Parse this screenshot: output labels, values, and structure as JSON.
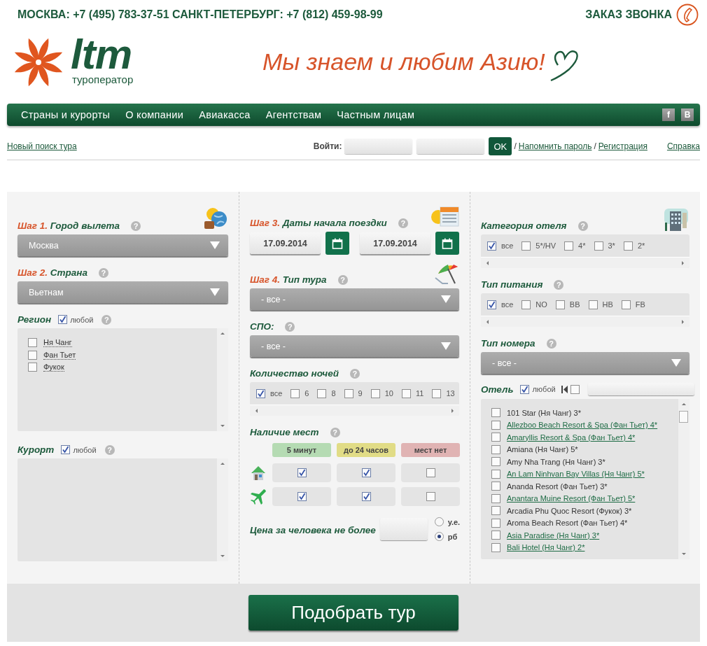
{
  "top_bar": {
    "phones": "МОСКВА: +7 (495) 783-37-51 САНКТ-ПЕТЕРБУРГ: +7 (812) 459-98-99",
    "callback": "ЗАКАЗ ЗВОНКА"
  },
  "logo": {
    "wordmark": "ltm",
    "subtitle": "туроператор"
  },
  "slogan": "Мы знаем и любим Азию!",
  "nav": {
    "items": [
      "Страны и курорты",
      "О компании",
      "Авиакасса",
      "Агентствам",
      "Частным лицам"
    ],
    "social": [
      "f",
      "В"
    ]
  },
  "account_bar": {
    "new_search": "Новый поиск тура",
    "login_label": "Войти:",
    "ok": "OK",
    "links": [
      {
        "kind": "sep",
        "text": "/"
      },
      {
        "kind": "link",
        "text": "Напомнить пароль"
      },
      {
        "kind": "sep",
        "text": "/"
      },
      {
        "kind": "link",
        "text": "Регистрация"
      }
    ],
    "help": "Справка"
  },
  "search_form": {
    "columns": [
      [
        {
          "kind": "select",
          "step": "Шаг 1.",
          "title": "Город вылета",
          "help": "?",
          "value": "Москва"
        },
        {
          "kind": "select",
          "step": "Шаг 2.",
          "title": "Страна",
          "help": "?",
          "value": "Вьетнам"
        },
        {
          "kind": "list",
          "title": "Регион",
          "any": {
            "label": "любой",
            "checked": true
          },
          "help": "?",
          "items": [
            {
              "label": "Ня Чанг",
              "checked": false
            },
            {
              "label": "Фан Тьет",
              "checked": false
            },
            {
              "label": "Фукок",
              "checked": false
            }
          ]
        },
        {
          "kind": "list",
          "title": "Курорт",
          "any": {
            "label": "любой",
            "checked": true
          },
          "help": "?"
        }
      ],
      [
        {
          "kind": "dates",
          "step": "Шаг 3.",
          "title": "Даты начала поездки",
          "help": "?",
          "dates": [
            "17.09.2014",
            "17.09.2014"
          ]
        },
        {
          "kind": "select",
          "step": "Шаг 4.",
          "title": "Тип тура",
          "help": "?",
          "value": "- все -"
        },
        {
          "kind": "select",
          "title": "СПО:",
          "help": "?",
          "value": "- все -"
        },
        {
          "kind": "strip",
          "title": "Количество ночей",
          "help": "?",
          "options": [
            {
              "label": "все",
              "checked": true
            },
            {
              "label": "6",
              "checked": false
            },
            {
              "label": "8",
              "checked": false
            },
            {
              "label": "9",
              "checked": false
            },
            {
              "label": "10",
              "checked": false
            },
            {
              "label": "11",
              "checked": false
            },
            {
              "label": "13",
              "checked": false
            }
          ]
        },
        {
          "kind": "availability",
          "title": "Наличие мест",
          "help": "?",
          "columns": [
            {
              "label": "5 минут",
              "color": "#b5dbb3"
            },
            {
              "label": "до 24 часов",
              "color": "#e1dc86"
            },
            {
              "label": "мест нет",
              "color": "#e0b3b3"
            }
          ],
          "rows": [
            {
              "kind": "hotel",
              "cells": [
                {
                  "checked": true
                },
                {
                  "checked": true
                },
                {
                  "checked": false
                }
              ]
            },
            {
              "kind": "flight",
              "cells": [
                {
                  "checked": true
                },
                {
                  "checked": true
                },
                {
                  "checked": false
                }
              ]
            }
          ]
        },
        {
          "kind": "price",
          "title": "Цена за человека не более",
          "currencies": [
            {
              "label": "у.е.",
              "selected": false
            },
            {
              "label": "рб",
              "selected": true
            }
          ]
        }
      ],
      [
        {
          "kind": "strip",
          "title": "Категория отеля",
          "help": "?",
          "options": [
            {
              "label": "все",
              "checked": true
            },
            {
              "label": "5*/HV",
              "checked": false
            },
            {
              "label": "4*",
              "checked": false
            },
            {
              "label": "3*",
              "checked": false
            },
            {
              "label": "2*",
              "checked": false
            }
          ]
        },
        {
          "kind": "strip",
          "title": "Тип питания",
          "help": "?",
          "options": [
            {
              "label": "все",
              "checked": true
            },
            {
              "label": "NO",
              "checked": false
            },
            {
              "label": "BB",
              "checked": false
            },
            {
              "label": "HB",
              "checked": false
            },
            {
              "label": "FB",
              "checked": false
            }
          ]
        },
        {
          "kind": "select",
          "title": "Тип номера",
          "help": "?",
          "value": "- все -"
        },
        {
          "kind": "hotels",
          "title": "Отель",
          "any": {
            "label": "любой",
            "checked": true
          },
          "filter": {
            "checked": false
          },
          "items": [
            {
              "label": "101 Star (Ня Чанг) 3*",
              "checked": false,
              "linked": false
            },
            {
              "label": "Allezboo Beach Resort & Spa (Фан Тьет) 4*",
              "checked": false,
              "linked": true
            },
            {
              "label": "Amaryllis Resort & Spa (Фан Тьет) 4*",
              "checked": false,
              "linked": true
            },
            {
              "label": "Amiana (Ня Чанг) 5*",
              "checked": false,
              "linked": false
            },
            {
              "label": "Amy Nha Trang (Ня Чанг) 3*",
              "checked": false,
              "linked": false
            },
            {
              "label": "An Lam Ninhvan Bay Villas (Ня Чанг) 5*",
              "checked": false,
              "linked": true
            },
            {
              "label": "Ananda Resort (Фан Тьет) 3*",
              "checked": false,
              "linked": false
            },
            {
              "label": "Anantara Muine Resort (Фан Тьет) 5*",
              "checked": false,
              "linked": true
            },
            {
              "label": "Arcadia Phu Quoc Resort (Фукок) 3*",
              "checked": false,
              "linked": false
            },
            {
              "label": "Aroma Beach Resort (Фан Тьет) 4*",
              "checked": false,
              "linked": false
            },
            {
              "label": "Asia Paradise (Ня Чанг) 3*",
              "checked": false,
              "linked": true
            },
            {
              "label": "Bali Hotel (Ня Чанг) 2*",
              "checked": false,
              "linked": true
            }
          ]
        }
      ]
    ],
    "submit": "Подобрать тур"
  }
}
